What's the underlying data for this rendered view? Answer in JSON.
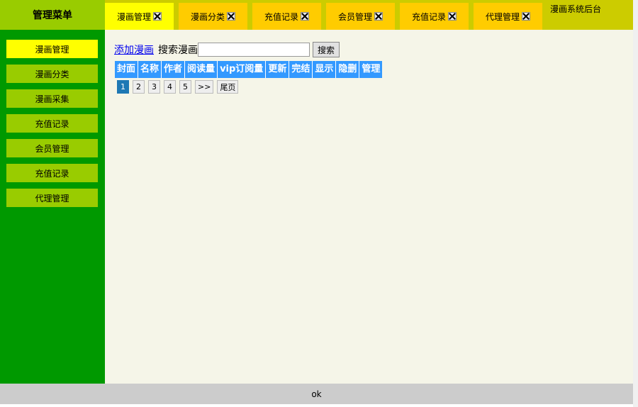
{
  "menu_title": "管理菜单",
  "system_title": "漫画系统后台",
  "tabs": [
    {
      "label": "漫画管理"
    },
    {
      "label": "漫画分类"
    },
    {
      "label": "充值记录"
    },
    {
      "label": "会员管理"
    },
    {
      "label": "充值记录"
    },
    {
      "label": "代理管理"
    }
  ],
  "sidebar": {
    "items": [
      {
        "label": "漫画管理"
      },
      {
        "label": "漫画分类"
      },
      {
        "label": "漫画采集"
      },
      {
        "label": "充值记录"
      },
      {
        "label": "会员管理"
      },
      {
        "label": "充值记录"
      },
      {
        "label": "代理管理"
      }
    ]
  },
  "toolbar": {
    "add_link": "添加漫画",
    "search_label": "搜索漫画",
    "search_value": "",
    "search_button": "搜索"
  },
  "table": {
    "headers": [
      "封面",
      "名称",
      "作者",
      "阅读量",
      "vip订阅量",
      "更新",
      "完结",
      "显示",
      "隐删",
      "管理"
    ]
  },
  "pager": {
    "pages": [
      "1",
      "2",
      "3",
      "4",
      "5"
    ],
    "current": "1",
    "next": ">>",
    "last": "尾页"
  },
  "footer": {
    "text": "ok"
  },
  "colors": {
    "topbar": "#cccc00",
    "menu_title_bg": "#99cc00",
    "tab_bg": "#ffcc00",
    "tab_active_bg": "#ffff00",
    "sidebar_bg": "#009900",
    "sidebar_item_bg": "#99cc00",
    "sidebar_active_bg": "#ffff00",
    "table_header_bg": "#3399ff",
    "main_bg": "#f5f5e8",
    "footer_bg": "#cccccc"
  },
  "icons": {
    "tab_close": "close-icon"
  }
}
